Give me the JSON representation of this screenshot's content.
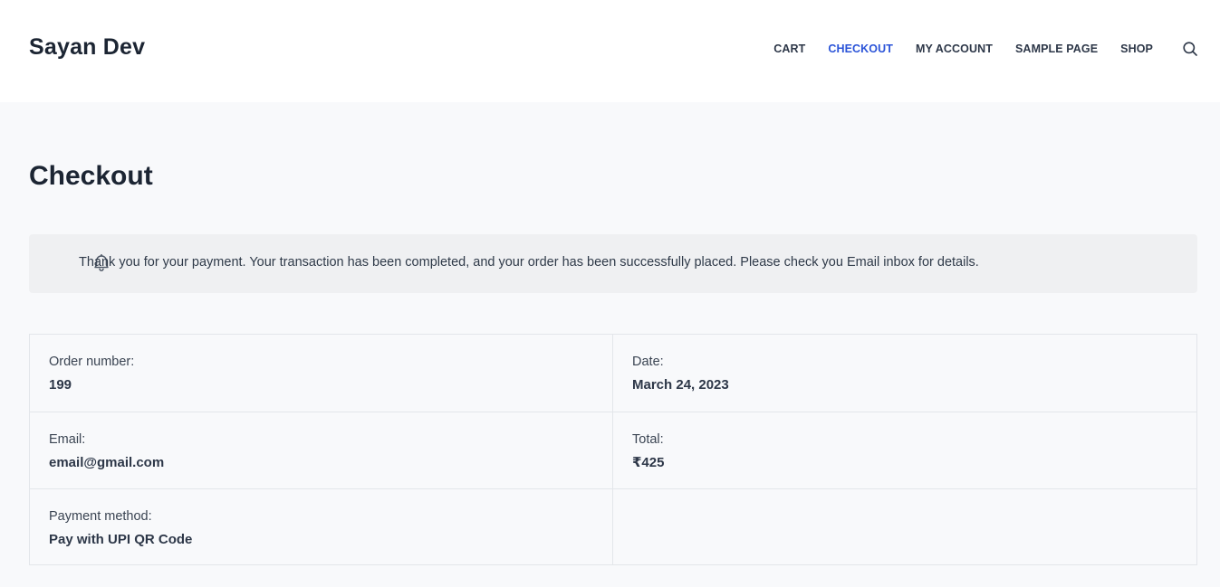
{
  "site": {
    "title": "Sayan Dev"
  },
  "nav": {
    "items": [
      {
        "label": "CART",
        "active": false
      },
      {
        "label": "CHECKOUT",
        "active": true
      },
      {
        "label": "MY ACCOUNT",
        "active": false
      },
      {
        "label": "SAMPLE PAGE",
        "active": false
      },
      {
        "label": "SHOP",
        "active": false
      }
    ],
    "search_icon": "search-icon"
  },
  "page": {
    "title": "Checkout"
  },
  "notice": {
    "icon": "bell-icon",
    "text": "Thank you for your payment. Your transaction has been completed, and your order has been successfully placed. Please check you Email inbox for details."
  },
  "order": {
    "order_number_label": "Order number:",
    "order_number": "199",
    "date_label": "Date:",
    "date": "March 24, 2023",
    "email_label": "Email:",
    "email": "email@gmail.com",
    "total_label": "Total:",
    "total": "₹425",
    "payment_label": "Payment method:",
    "payment": "Pay with UPI QR Code"
  },
  "colors": {
    "accent": "#2b54d8",
    "page_background": "#f8f9fb",
    "notice_background": "#eff0f2"
  }
}
